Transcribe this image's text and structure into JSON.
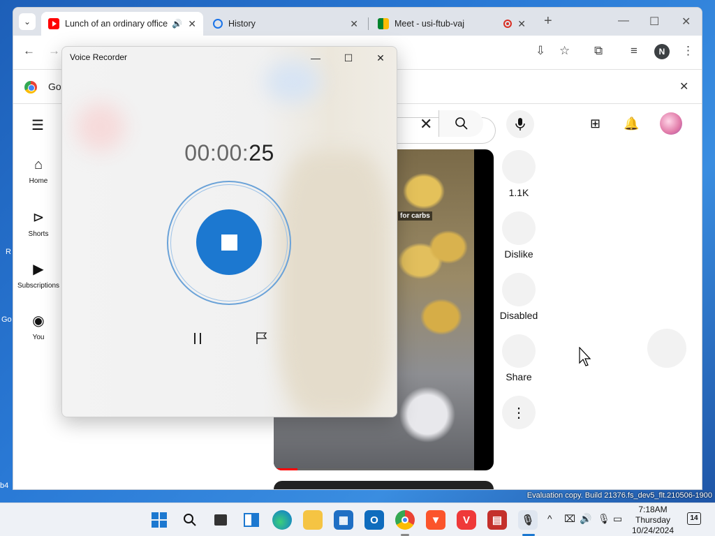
{
  "browser": {
    "tabs": [
      {
        "title": "Lunch of an ordinary office",
        "favicon": "youtube-icon",
        "active": true
      },
      {
        "title": "History",
        "favicon": "history-icon",
        "active": false
      },
      {
        "title": "Meet - usi-ftub-vaj",
        "favicon": "meet-icon",
        "active": false
      }
    ],
    "new_tab": "+",
    "profile_initial": "N",
    "infobar_text": "Go"
  },
  "youtube": {
    "nav": [
      {
        "label": "Home",
        "icon": "home-icon"
      },
      {
        "label": "Shorts",
        "icon": "shorts-icon"
      },
      {
        "label": "Subscriptions",
        "icon": "subscriptions-icon"
      },
      {
        "label": "You",
        "icon": "you-icon"
      }
    ],
    "video_caption": "for carbs",
    "video_progress": 0.12,
    "actions": [
      {
        "label": "1.1K",
        "icon": "like-icon"
      },
      {
        "label": "Dislike",
        "icon": "dislike-icon"
      },
      {
        "label": "Disabled",
        "icon": "comments-icon"
      },
      {
        "label": "Share",
        "icon": "share-icon"
      }
    ]
  },
  "recorder": {
    "title": "Voice Recorder",
    "timer_prefix": "00:00:",
    "timer_seconds": "25"
  },
  "desktop": {
    "watermark": "Evaluation copy. Build 21376.fs_dev5_flt.210506-1900"
  },
  "taskbar": {
    "time": "7:18AM",
    "day": "Thursday",
    "date": "10/24/2024",
    "notification_count": "14"
  },
  "colors": {
    "accent": "#1c78d0",
    "youtube_red": "#ff0000"
  }
}
